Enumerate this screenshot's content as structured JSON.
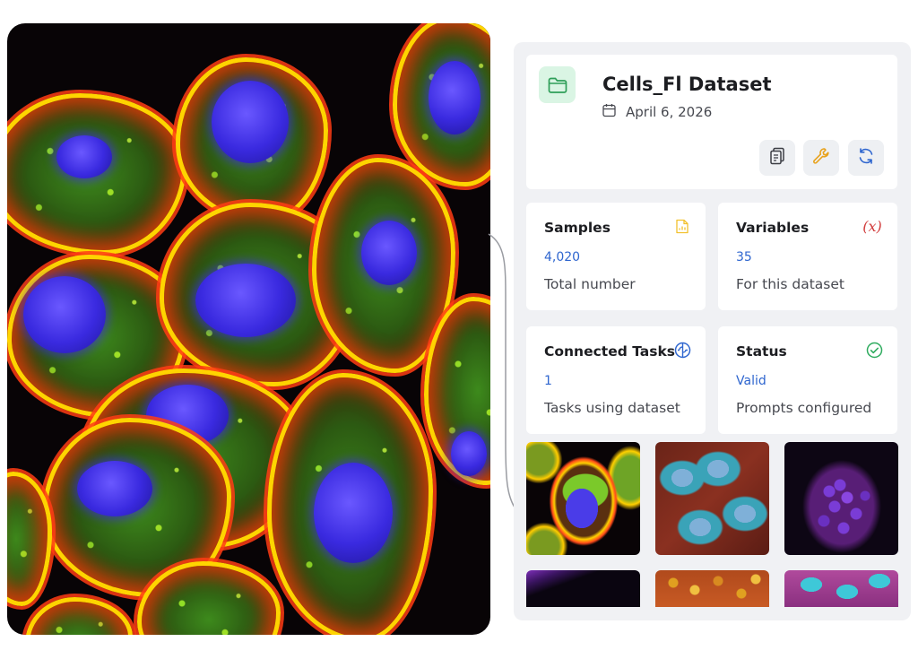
{
  "hero": {
    "icon": "fluorescence-microscopy-image"
  },
  "dataset": {
    "title": "Cells_Fl Dataset",
    "date": "April 6, 2026",
    "icons": {
      "folder": "folder-icon",
      "calendar": "calendar-icon"
    },
    "actions": [
      {
        "name": "copy-button",
        "icon": "clipboard-icon"
      },
      {
        "name": "settings-button",
        "icon": "wrench-icon"
      },
      {
        "name": "refresh-button",
        "icon": "refresh-icon"
      }
    ]
  },
  "stats": {
    "samples": {
      "label": "Samples",
      "value": "4,020",
      "sub": "Total number",
      "icon": "file-chart-icon",
      "color": "#f2c12e"
    },
    "variables": {
      "label": "Variables",
      "value": "35",
      "sub": "For this dataset",
      "icon": "function-x-icon",
      "color": "#d13b3b"
    },
    "tasks": {
      "label": "Connected Tasks",
      "value": "1",
      "sub": "Tasks using dataset",
      "icon": "brain-icon",
      "color": "#2f66cf"
    },
    "status": {
      "label": "Status",
      "value": "Valid",
      "sub": "Prompts configured",
      "icon": "check-circle-icon",
      "color": "#2eab5e"
    }
  },
  "colors": {
    "accent_blue": "#2f66cf",
    "panel_bg": "#f0f1f4",
    "folder_tile": "#daf5e4",
    "folder_icon": "#2e9e58",
    "wrench": "#e8a21c"
  },
  "thumbnails": [
    "thumbnail-cells-yellow-green",
    "thumbnail-cells-red-cyan",
    "thumbnail-cells-purple-nuclei",
    "thumbnail-cells-purple-dark",
    "thumbnail-cells-orange-colony",
    "thumbnail-cells-pink-cyan"
  ]
}
